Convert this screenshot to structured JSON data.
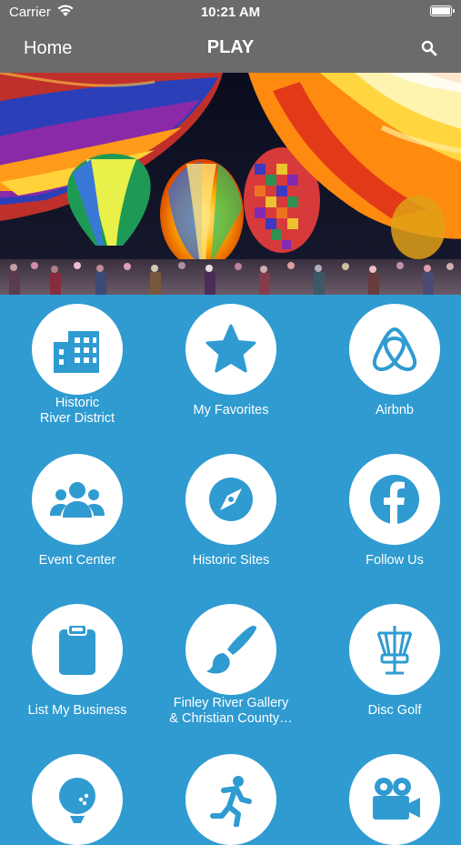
{
  "status_bar": {
    "carrier": "Carrier",
    "time": "10:21 AM"
  },
  "nav": {
    "back_label": "Home",
    "title": "PLAY"
  },
  "tiles": [
    {
      "label": "Historic\nRiver District",
      "icon": "building-icon"
    },
    {
      "label": "My Favorites",
      "icon": "star-icon"
    },
    {
      "label": "Airbnb",
      "icon": "airbnb-icon"
    },
    {
      "label": "Event Center",
      "icon": "people-group-icon"
    },
    {
      "label": "Historic Sites",
      "icon": "compass-icon"
    },
    {
      "label": "Follow Us",
      "icon": "facebook-icon"
    },
    {
      "label": "List My Business",
      "icon": "clipboard-icon"
    },
    {
      "label": "Finley River Gallery\n& Christian County…",
      "icon": "paintbrush-icon"
    },
    {
      "label": "Disc Golf",
      "icon": "disc-golf-basket-icon"
    },
    {
      "label": "",
      "icon": "golf-ball-icon"
    },
    {
      "label": "",
      "icon": "runner-icon"
    },
    {
      "label": "",
      "icon": "movie-camera-icon"
    }
  ],
  "colors": {
    "accent": "#2f9bd1",
    "nav_bg": "#6b6b6b"
  }
}
